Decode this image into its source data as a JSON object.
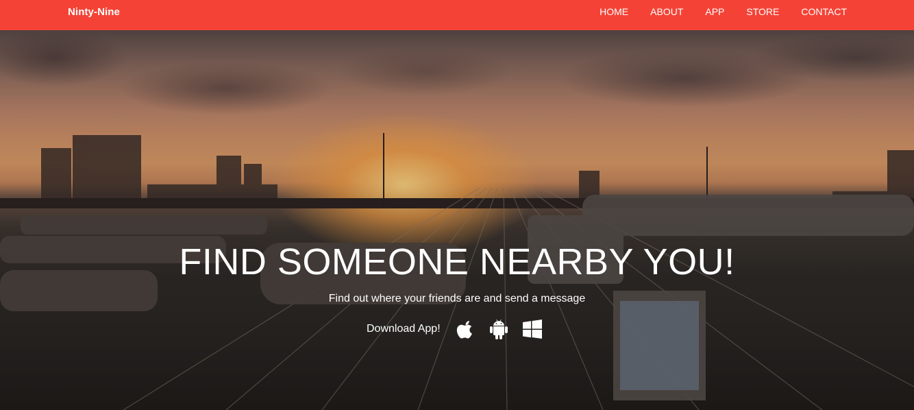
{
  "navbar": {
    "brand": "Ninty-Nine",
    "links": [
      "HOME",
      "ABOUT",
      "APP",
      "STORE",
      "CONTACT"
    ],
    "background_color": "#f44336"
  },
  "hero": {
    "headline": "FIND SOMEONE NEARBY YOU!",
    "subtitle": "Find out where your friends are and send a message",
    "download_label": "Download App!",
    "store_icons": [
      "apple-icon",
      "android-icon",
      "windows-icon"
    ]
  }
}
